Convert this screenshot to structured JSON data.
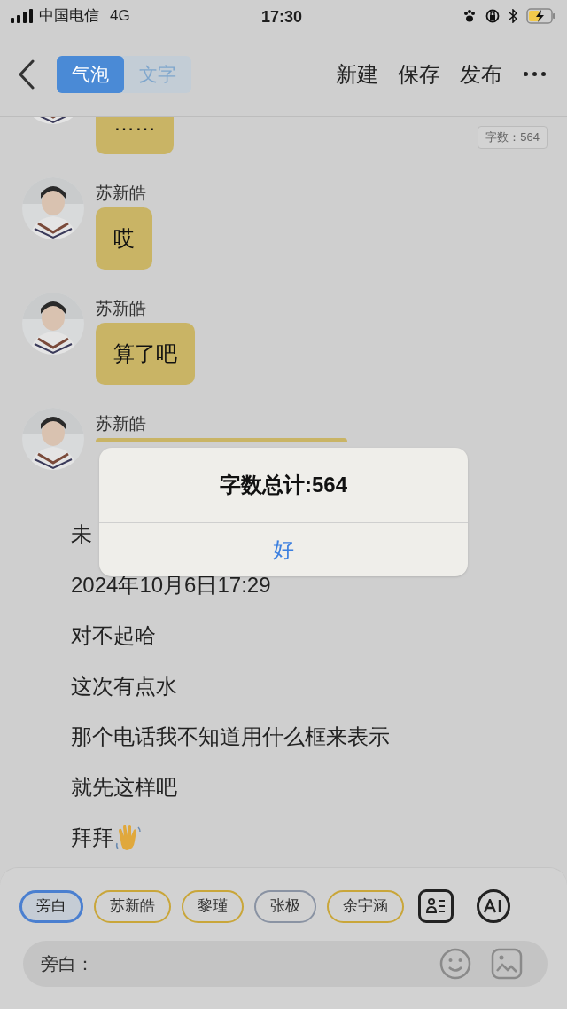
{
  "status_bar": {
    "carrier": "中国电信",
    "network": "4G",
    "time": "17:30"
  },
  "nav": {
    "tabs": [
      {
        "label": "气泡",
        "selected": true
      },
      {
        "label": "文字",
        "selected": false
      }
    ],
    "actions": [
      "新建",
      "保存",
      "发布"
    ]
  },
  "word_count_badge": "字数：564",
  "messages": [
    {
      "text": "……",
      "kind": "cut"
    },
    {
      "name": "苏新皓",
      "text": "哎",
      "kind": "bubble"
    },
    {
      "name": "苏新皓",
      "text": "算了吧",
      "kind": "bubble"
    },
    {
      "name": "苏新皓",
      "kind": "covered"
    }
  ],
  "narration": [
    "未",
    "2024年10月6日17:29",
    "对不起哈",
    "这次有点水",
    "那个电话我不知道用什么框来表示",
    "就先这样吧",
    "拜拜"
  ],
  "roles": [
    {
      "label": "旁白",
      "selected": true,
      "color": "#4a7fd0"
    },
    {
      "label": "苏新皓",
      "selected": false,
      "color": "#c9a63a"
    },
    {
      "label": "黎瑾",
      "selected": false,
      "color": "#c9a63a"
    },
    {
      "label": "张极",
      "selected": false,
      "color": "#8a93a3"
    },
    {
      "label": "余宇涵",
      "selected": false,
      "color": "#c9a63a"
    }
  ],
  "input": {
    "placeholder": "旁白："
  },
  "dialog": {
    "title": "字数总计:564",
    "button": "好"
  }
}
